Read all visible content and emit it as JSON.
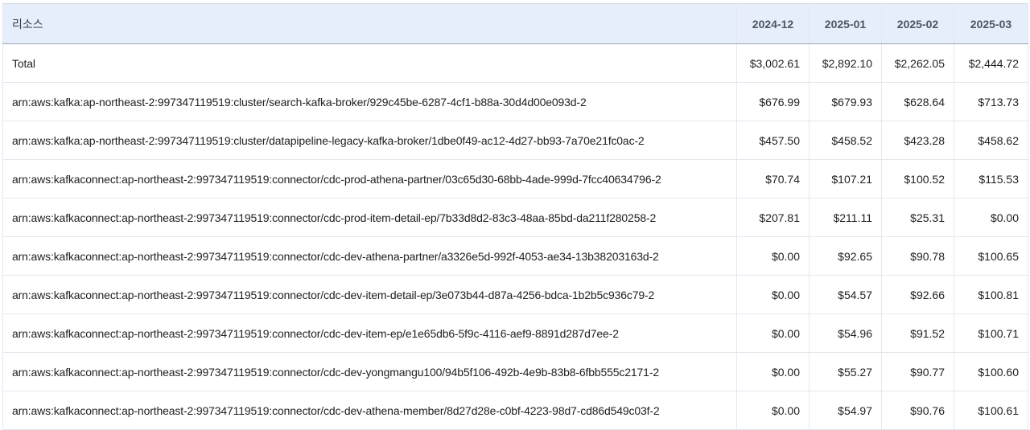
{
  "table": {
    "columns": [
      "리소스",
      "2024-12",
      "2025-01",
      "2025-02",
      "2025-03"
    ],
    "rows": [
      {
        "resource": "Total",
        "values": [
          "$3,002.61",
          "$2,892.10",
          "$2,262.05",
          "$2,444.72"
        ]
      },
      {
        "resource": "arn:aws:kafka:ap-northeast-2:997347119519:cluster/search-kafka-broker/929c45be-6287-4cf1-b88a-30d4d00e093d-2",
        "values": [
          "$676.99",
          "$679.93",
          "$628.64",
          "$713.73"
        ]
      },
      {
        "resource": "arn:aws:kafka:ap-northeast-2:997347119519:cluster/datapipeline-legacy-kafka-broker/1dbe0f49-ac12-4d27-bb93-7a70e21fc0ac-2",
        "values": [
          "$457.50",
          "$458.52",
          "$423.28",
          "$458.62"
        ]
      },
      {
        "resource": "arn:aws:kafkaconnect:ap-northeast-2:997347119519:connector/cdc-prod-athena-partner/03c65d30-68bb-4ade-999d-7fcc40634796-2",
        "values": [
          "$70.74",
          "$107.21",
          "$100.52",
          "$115.53"
        ]
      },
      {
        "resource": "arn:aws:kafkaconnect:ap-northeast-2:997347119519:connector/cdc-prod-item-detail-ep/7b33d8d2-83c3-48aa-85bd-da211f280258-2",
        "values": [
          "$207.81",
          "$211.11",
          "$25.31",
          "$0.00"
        ]
      },
      {
        "resource": "arn:aws:kafkaconnect:ap-northeast-2:997347119519:connector/cdc-dev-athena-partner/a3326e5d-992f-4053-ae34-13b38203163d-2",
        "values": [
          "$0.00",
          "$92.65",
          "$90.78",
          "$100.65"
        ]
      },
      {
        "resource": "arn:aws:kafkaconnect:ap-northeast-2:997347119519:connector/cdc-dev-item-detail-ep/3e073b44-d87a-4256-bdca-1b2b5c936c79-2",
        "values": [
          "$0.00",
          "$54.57",
          "$92.66",
          "$100.81"
        ]
      },
      {
        "resource": "arn:aws:kafkaconnect:ap-northeast-2:997347119519:connector/cdc-dev-item-ep/e1e65db6-5f9c-4116-aef9-8891d287d7ee-2",
        "values": [
          "$0.00",
          "$54.96",
          "$91.52",
          "$100.71"
        ]
      },
      {
        "resource": "arn:aws:kafkaconnect:ap-northeast-2:997347119519:connector/cdc-dev-yongmangu100/94b5f106-492b-4e9b-83b8-6fbb555c2171-2",
        "values": [
          "$0.00",
          "$55.27",
          "$90.77",
          "$100.60"
        ]
      },
      {
        "resource": "arn:aws:kafkaconnect:ap-northeast-2:997347119519:connector/cdc-dev-athena-member/8d27d28e-c0bf-4223-98d7-cd86d549c03f-2",
        "values": [
          "$0.00",
          "$54.97",
          "$90.76",
          "$100.61"
        ]
      }
    ]
  }
}
